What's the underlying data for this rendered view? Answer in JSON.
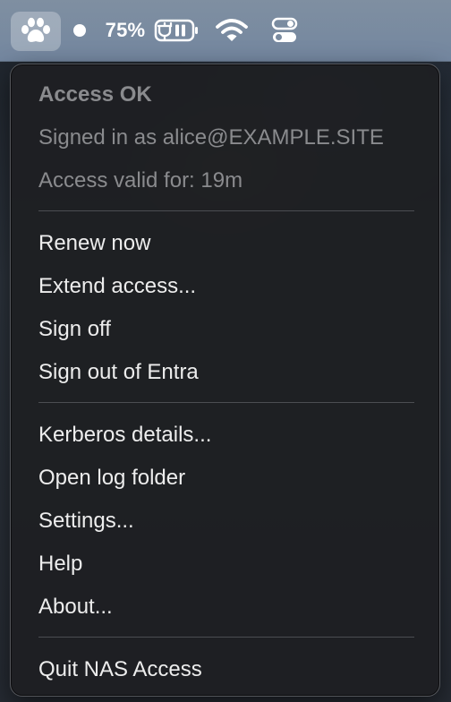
{
  "menubar": {
    "app_icon": "paw-icon",
    "status_dot_icon": "status-dot-icon",
    "battery_percent": "75%",
    "battery_icon": "battery-charging-icon",
    "wifi_icon": "wifi-icon",
    "control_center_icon": "control-center-icon"
  },
  "menu": {
    "status": {
      "title": "Access OK",
      "signed_in": "Signed in as alice@EXAMPLE.SITE",
      "valid_for": "Access valid for: 19m"
    },
    "actions": [
      {
        "label": "Renew now"
      },
      {
        "label": "Extend access..."
      },
      {
        "label": "Sign off"
      },
      {
        "label": "Sign out of Entra"
      }
    ],
    "tools": [
      {
        "label": "Kerberos details..."
      },
      {
        "label": "Open log folder"
      },
      {
        "label": "Settings..."
      },
      {
        "label": "Help"
      },
      {
        "label": "About..."
      }
    ],
    "quit": {
      "label": "Quit NAS Access"
    }
  },
  "colors": {
    "menubar_bg": "#7a8ba0",
    "menu_bg": "#1e1f22",
    "menu_text": "#ededed",
    "disabled_text": "#8a8b8e",
    "separator": "#4b4d52"
  }
}
